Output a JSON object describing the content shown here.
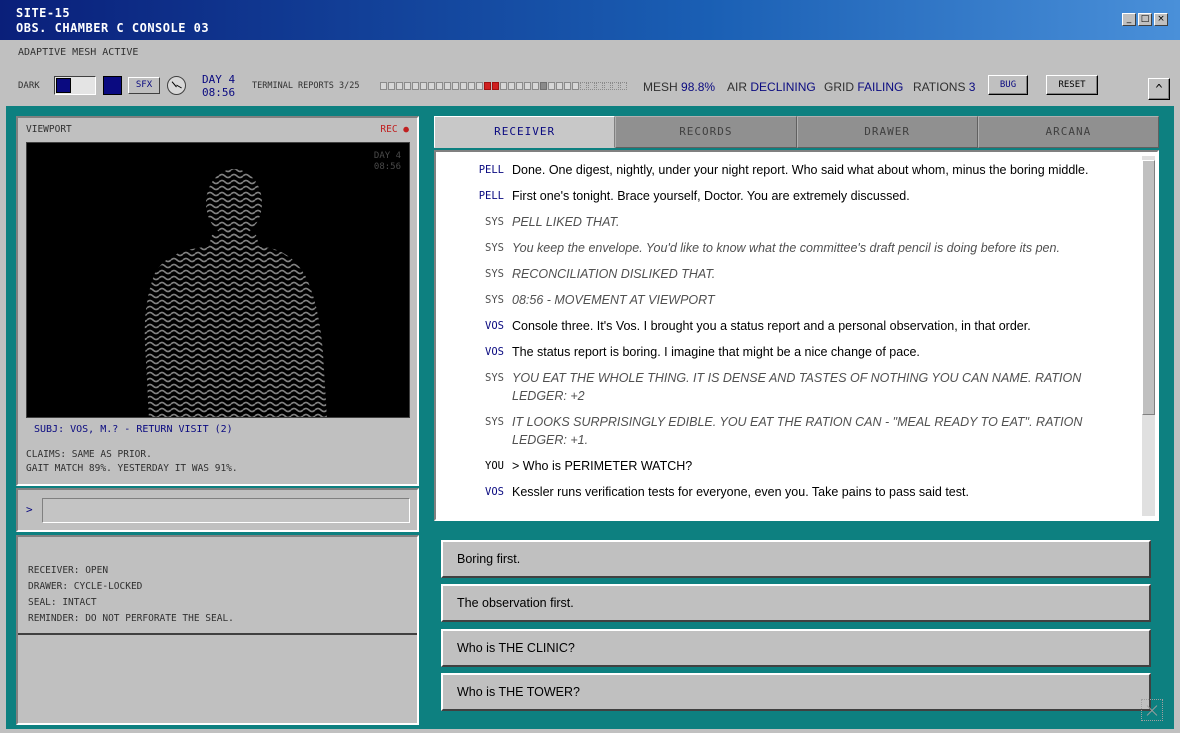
{
  "titlebar": {
    "line1": "SITE-15",
    "line2": "OBS. CHAMBER C CONSOLE 03",
    "minimize": "_",
    "maximize": "□",
    "close": "×"
  },
  "header": {
    "mesh_status": "ADAPTIVE MESH ACTIVE",
    "dark_label": "DARK",
    "sfx_label": "SFX",
    "day": "DAY 4",
    "time": "08:56",
    "reports_label": "TERMINAL REPORTS 3/25",
    "stats": {
      "mesh_label": "MESH",
      "mesh_value": "98.8%",
      "air_label": "AIR",
      "air_value": "DECLINING",
      "grid_label": "GRID",
      "grid_value": "FAILING",
      "rations_label": "RATIONS",
      "rations_value": "3"
    },
    "bug_label": "BUG",
    "reset_label": "RESET",
    "collapse_icon": "^"
  },
  "viewport": {
    "label": "VIEWPORT",
    "rec": "REC ●",
    "overlay_day": "DAY 4",
    "overlay_time": "08:56",
    "subject": "SUBJ: VOS, M.? - RETURN VISIT (2)",
    "claims_line1": "CLAIMS: SAME AS PRIOR.",
    "claims_line2": "GAIT MATCH 89%. YESTERDAY IT WAS 91%."
  },
  "command": {
    "prompt": ">",
    "value": ""
  },
  "status": {
    "receiver": "RECEIVER: OPEN",
    "drawer": "DRAWER: CYCLE-LOCKED",
    "seal": "SEAL: INTACT",
    "reminder": "REMINDER: DO NOT PERFORATE THE SEAL."
  },
  "tabs": [
    "RECEIVER",
    "RECORDS",
    "DRAWER",
    "ARCANA"
  ],
  "log": [
    {
      "speaker": "PELL",
      "text": "Done. One digest, nightly, under your night report. Who said what about whom, minus the boring middle.",
      "kind": "npc"
    },
    {
      "speaker": "PELL",
      "text": "First one's tonight. Brace yourself, Doctor. You are extremely discussed.",
      "kind": "npc"
    },
    {
      "speaker": "SYS",
      "text": "PELL LIKED THAT.",
      "kind": "sys"
    },
    {
      "speaker": "SYS",
      "text": "You keep the envelope. You'd like to know what the committee's draft pencil is doing before its pen.",
      "kind": "sys"
    },
    {
      "speaker": "SYS",
      "text": "RECONCILIATION DISLIKED THAT.",
      "kind": "sys"
    },
    {
      "speaker": "SYS",
      "text": "08:56 - MOVEMENT AT VIEWPORT",
      "kind": "sys"
    },
    {
      "speaker": "VOS",
      "text": "Console three. It's Vos. I brought you a status report and a personal observation, in that order.",
      "kind": "npc"
    },
    {
      "speaker": "VOS",
      "text": "The status report is boring. I imagine that might be a nice change of pace.",
      "kind": "npc"
    },
    {
      "speaker": "SYS",
      "text": "YOU EAT THE WHOLE THING. IT IS DENSE AND TASTES OF NOTHING YOU CAN NAME. RATION LEDGER: +2",
      "kind": "sys"
    },
    {
      "speaker": "SYS",
      "text": "IT LOOKS SURPRISINGLY EDIBLE. YOU EAT THE RATION CAN - \"MEAL READY TO EAT\". RATION LEDGER: +1.",
      "kind": "sys"
    },
    {
      "speaker": "YOU",
      "text": "> Who is PERIMETER WATCH?",
      "kind": "you"
    },
    {
      "speaker": "VOS",
      "text": "Kessler runs verification tests for everyone, even you. Take pains to pass said test.",
      "kind": "npc"
    }
  ],
  "choices": [
    "Boring first.",
    "The observation first.",
    "Who is THE CLINIC?",
    "Who is THE TOWER?"
  ],
  "icons": {
    "clock": "clock-icon",
    "resize": "resize-icon"
  }
}
